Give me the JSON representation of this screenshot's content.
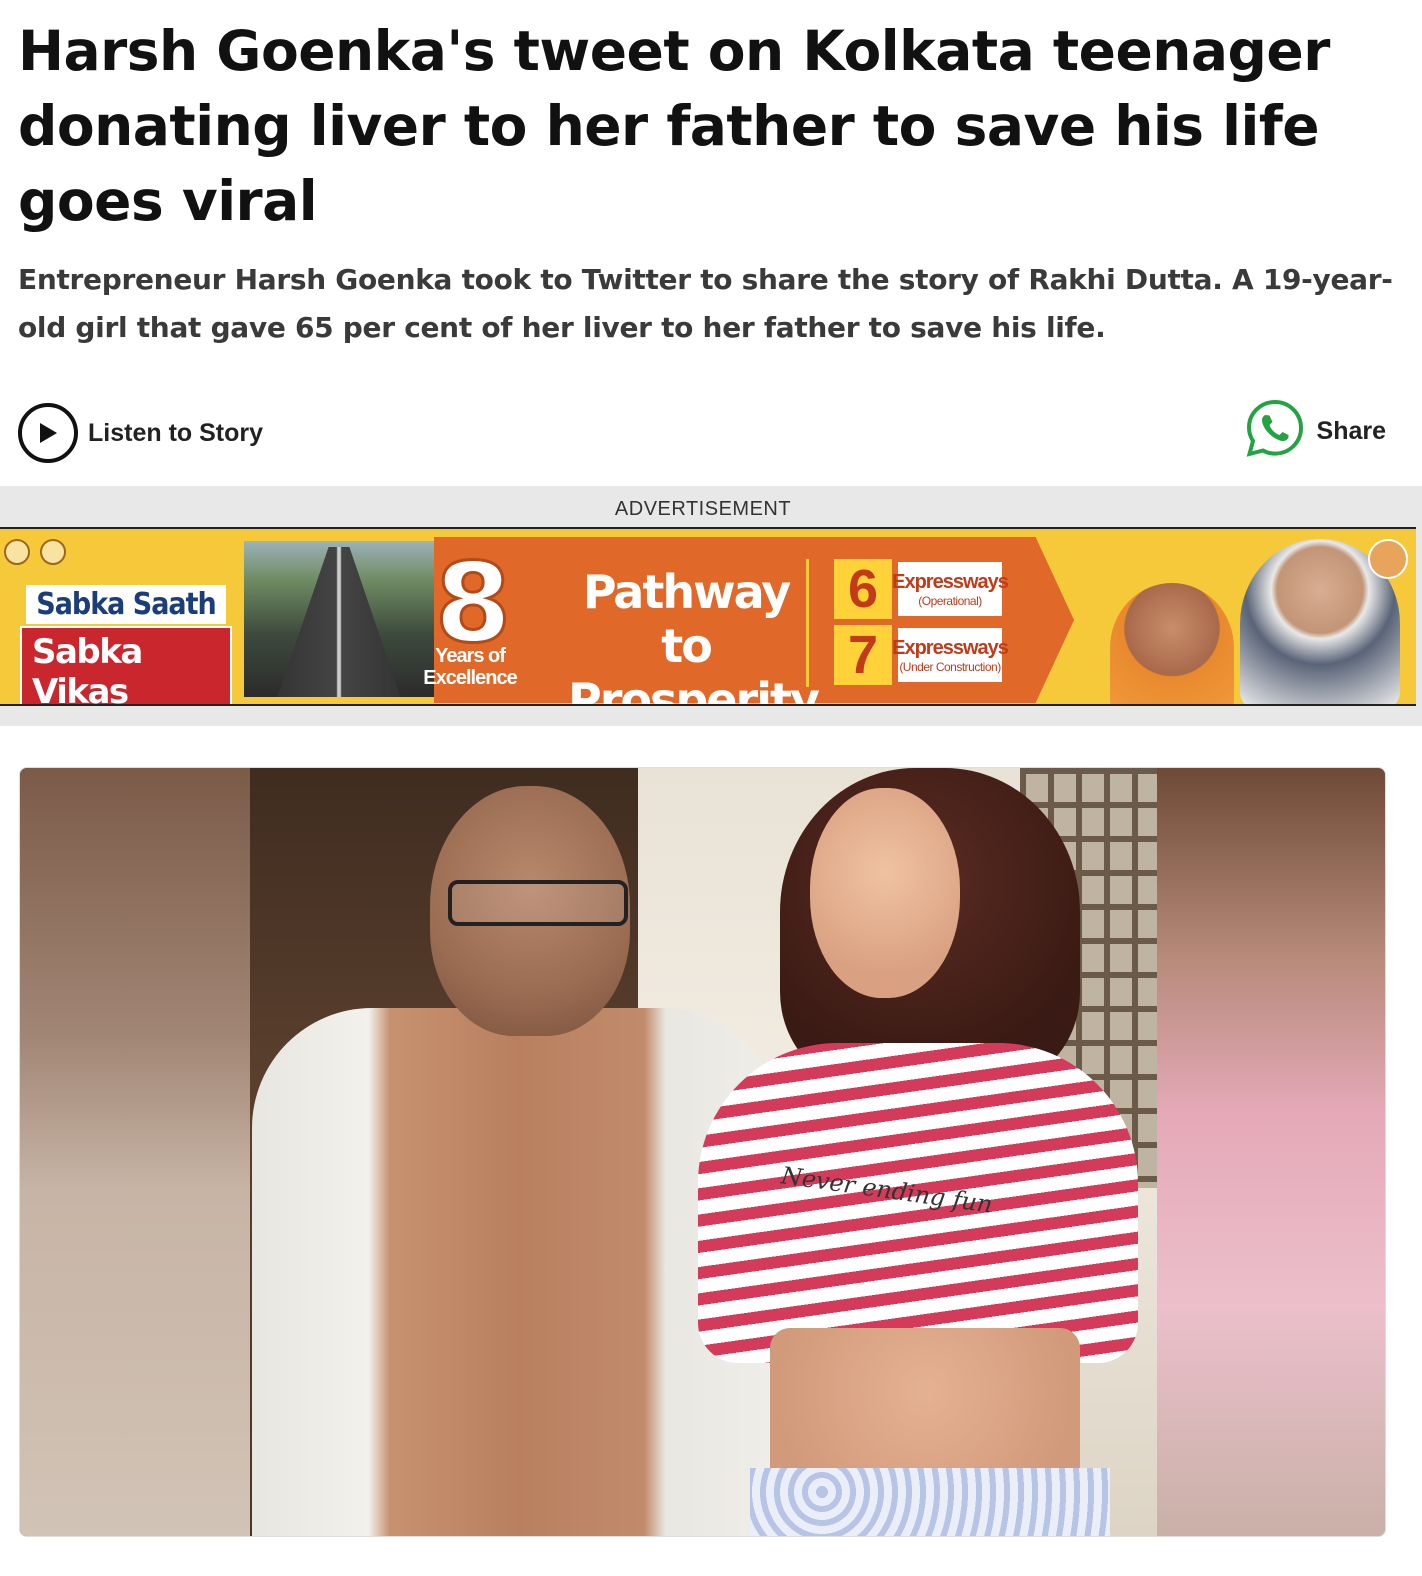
{
  "article": {
    "headline": "Harsh Goenka's tweet on Kolkata teenager donating liver to her father to save his life goes viral",
    "summary": "Entrepreneur Harsh Goenka took to Twitter to share the story of Rakhi Dutta. A 19-year-old girl that gave 65 per cent of her liver to her father to save his life."
  },
  "actions": {
    "listen_label": "Listen to Story",
    "listen_icon": "play-icon",
    "share_label": "Share",
    "share_icon": "whatsapp-icon"
  },
  "advertisement": {
    "label": "ADVERTISEMENT",
    "slogan_top": "Sabka Saath",
    "slogan_bottom": "Sabka Vikas",
    "years_number": "8",
    "years_text_1": "Years of",
    "years_text_2": "Excellence",
    "headline_1": "Pathway to",
    "headline_2": "Prosperity",
    "stat1_number": "6",
    "stat1_label": "Expressways",
    "stat1_sub": "(Operational)",
    "stat2_number": "7",
    "stat2_label": "Expressways",
    "stat2_sub": "(Under Construction)"
  },
  "photo": {
    "shirt_text": "Never ending fun"
  },
  "colors": {
    "ad_yellow": "#f5c93a",
    "ad_orange": "#e06828",
    "ad_red": "#c9272d",
    "whatsapp_green": "#25a244"
  }
}
